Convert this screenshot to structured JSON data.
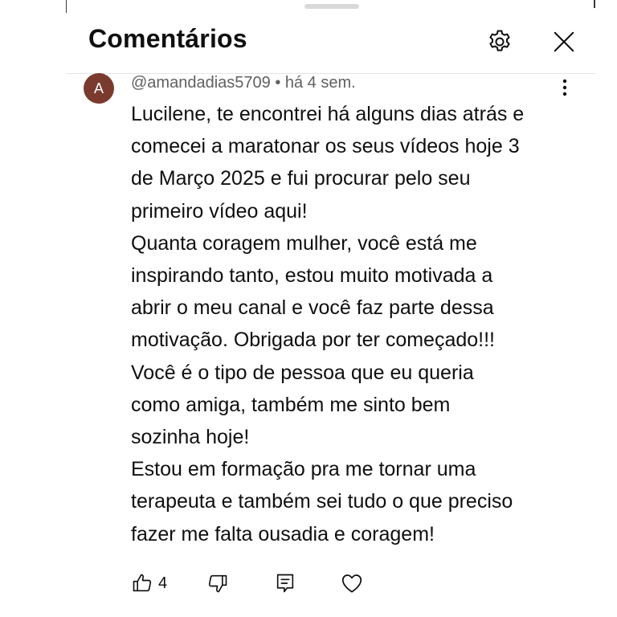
{
  "header": {
    "title": "Comentários"
  },
  "comment": {
    "avatar_letter": "A",
    "meta": "@amandadias5709 • há 4 sem.",
    "lines": [
      "Lucilene, te encontrei há alguns dias atrás e",
      "comecei a maratonar os seus vídeos hoje 3",
      "de Março 2025 e fui procurar pelo seu",
      "primeiro vídeo aqui!",
      "Quanta coragem mulher, você está me",
      "inspirando tanto, estou muito motivada a",
      "abrir o meu canal e você faz parte dessa",
      "motivação. Obrigada por ter começado!!!",
      "Você é o tipo de pessoa que eu queria",
      "como amiga, também me sinto bem",
      "sozinha hoje!",
      "Estou em formação pra me tornar uma",
      "terapeuta e também sei tudo o que preciso",
      "fazer me falta ousadia e coragem!"
    ],
    "like_count": "4"
  },
  "icons": {
    "settings": "gear-icon",
    "close": "close-icon",
    "menu": "more-vertical-icon",
    "like": "thumb-up-icon",
    "dislike": "thumb-down-icon",
    "reply": "reply-comment-icon",
    "heart": "heart-icon"
  },
  "colors": {
    "text": "#0f0f0f",
    "meta_text": "#606060",
    "avatar_bg": "#7a3b2e"
  }
}
